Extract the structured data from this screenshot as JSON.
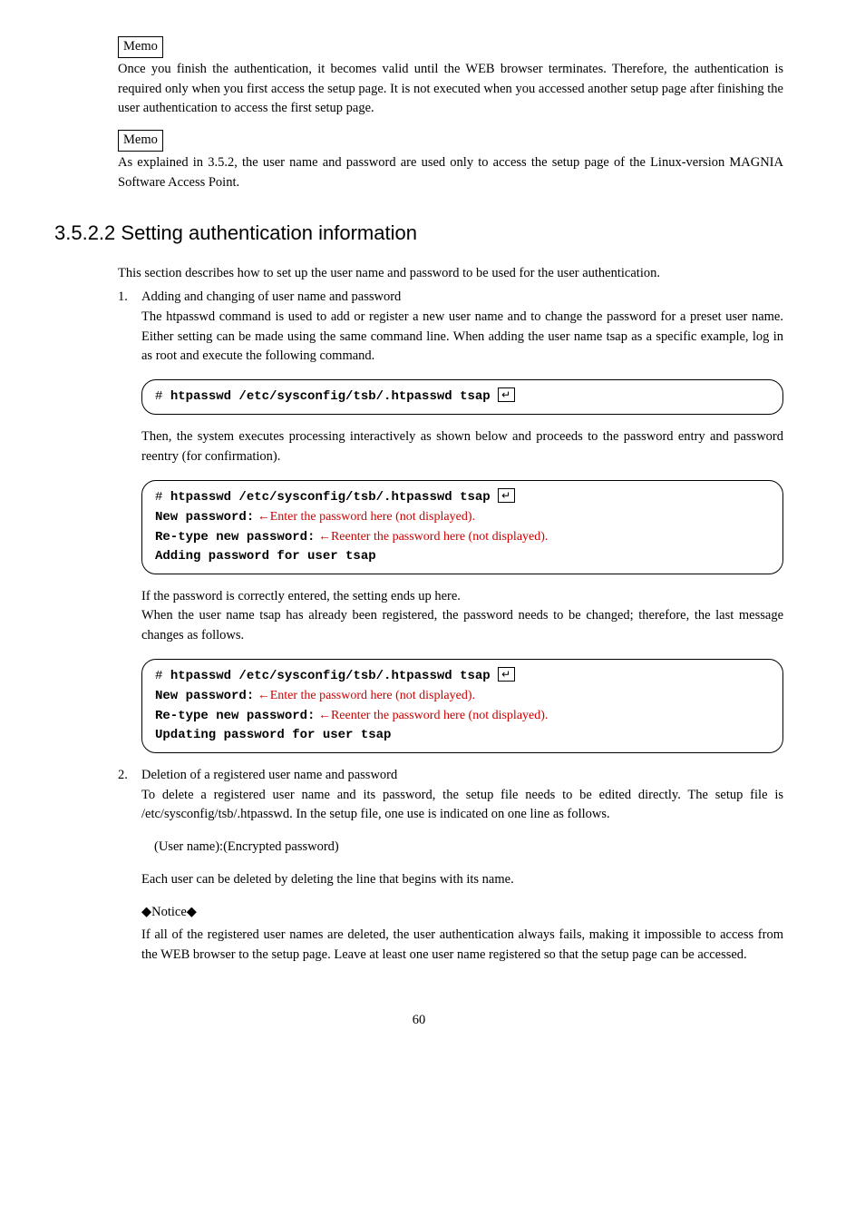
{
  "memo1": {
    "label": "Memo",
    "text": "Once you finish the authentication, it becomes valid until the WEB browser terminates.  Therefore, the authentication is required only when you first access the setup page.  It is not executed when you accessed another setup page after finishing the user authentication to access the first setup page."
  },
  "memo2": {
    "label": "Memo",
    "text": "As explained in 3.5.2, the user name and password are used only to access the setup page of the Linux-version MAGNIA Software Access Point."
  },
  "heading": "3.5.2.2  Setting authentication information",
  "intro": "This section describes how to set up the user name and password to be used for the user authentication.",
  "item1": {
    "num": "1.",
    "title": "Adding and changing of user name and password",
    "desc": "The htpasswd command is used to add or register a new user name and to change the password for a preset user name.  Either setting can be made using the same command line.  When adding the user name tsap as a specific example, log in as root and execute the following command."
  },
  "code1": {
    "prompt": "# ",
    "cmd": "htpasswd /etc/sysconfig/tsb/.htpasswd tsap",
    "enter": "↵"
  },
  "after_code1": "Then, the system executes processing interactively as shown below and proceeds to the password entry and password reentry (for confirmation).",
  "code2": {
    "prompt": "# ",
    "cmd": "htpasswd /etc/sysconfig/tsb/.htpasswd tsap",
    "enter": "↵",
    "line2_label": "New password:",
    "line2_note": " ←Enter the password here (not displayed).",
    "line3_label": "Re-type new password:",
    "line3_note": " ←Reenter the password here (not displayed).",
    "line4": "Adding password for user tsap"
  },
  "after_code2_a": " If the password is correctly entered, the setting ends up here.",
  "after_code2_b": "When the user name tsap has already been registered, the password needs to be changed; therefore, the last message changes as follows.",
  "code3": {
    "prompt": "# ",
    "cmd": "htpasswd /etc/sysconfig/tsb/.htpasswd tsap",
    "enter": "↵",
    "line2_label": "New password:",
    "line2_note": " ←Enter the password here (not displayed).",
    "line3_label": "Re-type new password:",
    "line3_note": " ←Reenter the password here (not displayed).",
    "line4": "Updating password for user tsap"
  },
  "item2": {
    "num": "2.",
    "title": "Deletion of a registered user name and password",
    "desc": "To delete a registered user name and its password, the setup file needs to be edited directly.  The setup file is /etc/sysconfig/tsb/.htpasswd.  In the setup file, one use is indicated on one line as follows.",
    "format": "(User name):(Encrypted password)",
    "desc2": "Each user can be deleted by deleting the line that begins with its name."
  },
  "notice": {
    "label": "◆Notice◆",
    "text": "If all of the registered user names are deleted, the user authentication always fails, making it impossible to access from the WEB browser to the setup page.  Leave at least one user name registered so that the setup page can be accessed."
  },
  "page_number": "60"
}
